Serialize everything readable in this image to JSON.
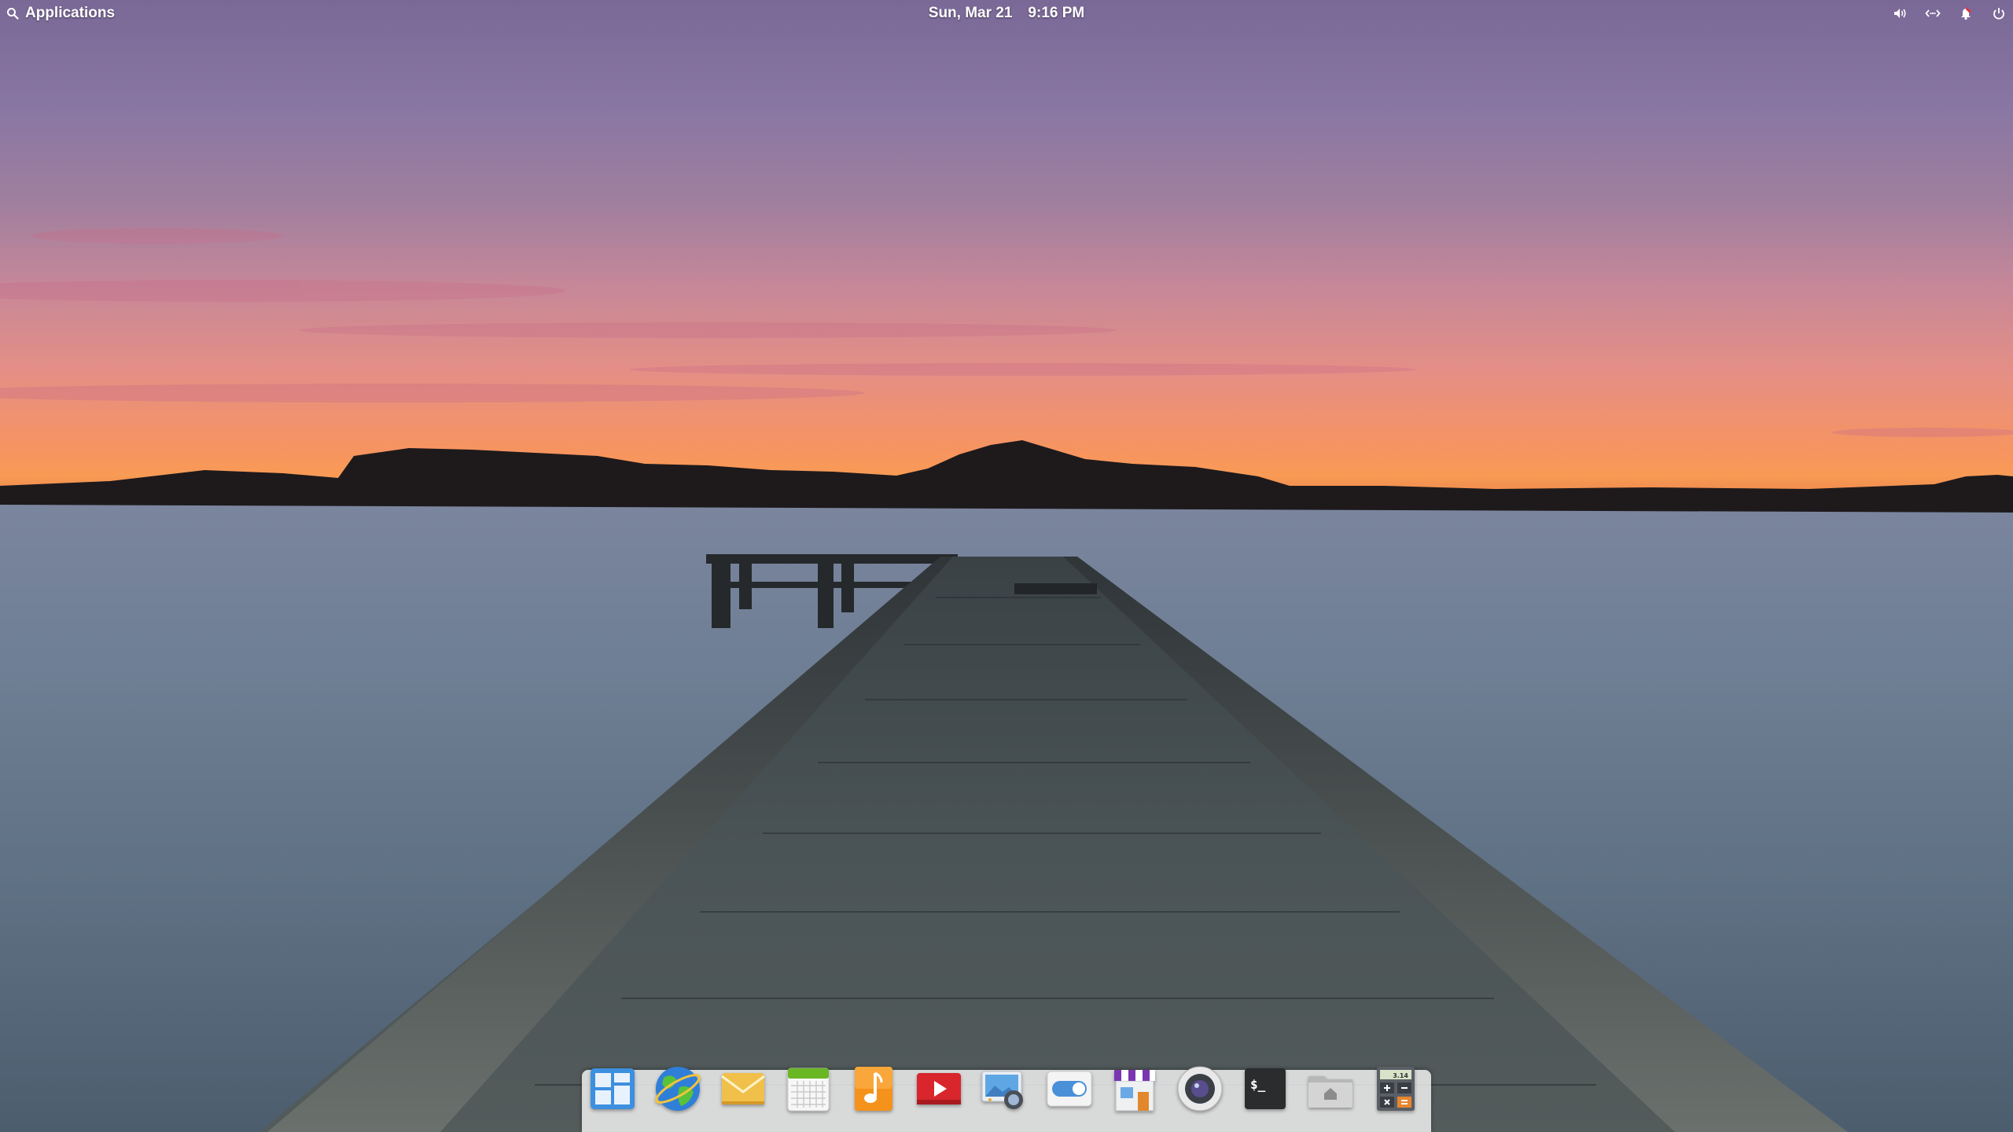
{
  "desktop": {
    "wallpaper": "sunset-pier-lake"
  },
  "top_panel": {
    "applications_label": "Applications",
    "applications_icon": "search-icon",
    "date": "Sun, Mar 21",
    "time": "9:16 PM",
    "indicators": [
      {
        "name": "volume",
        "icon": "volume-icon"
      },
      {
        "name": "network",
        "icon": "network-wired-icon"
      },
      {
        "name": "notifications",
        "icon": "notification-icon"
      },
      {
        "name": "session",
        "icon": "power-icon"
      }
    ]
  },
  "dock": {
    "items": [
      {
        "app": "multitasking-view",
        "icon": "multitasking-view-icon"
      },
      {
        "app": "web-browser",
        "icon": "web-browser-icon"
      },
      {
        "app": "mail",
        "icon": "mail-icon"
      },
      {
        "app": "calendar",
        "icon": "calendar-icon"
      },
      {
        "app": "music",
        "icon": "music-icon"
      },
      {
        "app": "videos",
        "icon": "videos-icon"
      },
      {
        "app": "photos",
        "icon": "photos-icon"
      },
      {
        "app": "system-settings",
        "icon": "settings-toggle-icon"
      },
      {
        "app": "appcenter",
        "icon": "appcenter-icon"
      },
      {
        "app": "camera",
        "icon": "camera-icon"
      },
      {
        "app": "terminal",
        "icon": "terminal-icon"
      },
      {
        "app": "files",
        "icon": "files-icon"
      },
      {
        "app": "calculator",
        "icon": "calculator-icon",
        "display": "3.14"
      }
    ]
  },
  "colors": {
    "panel_text": "#ffffff",
    "notification_accent": "#e0303a",
    "dock_background": "#f5f5f5"
  }
}
